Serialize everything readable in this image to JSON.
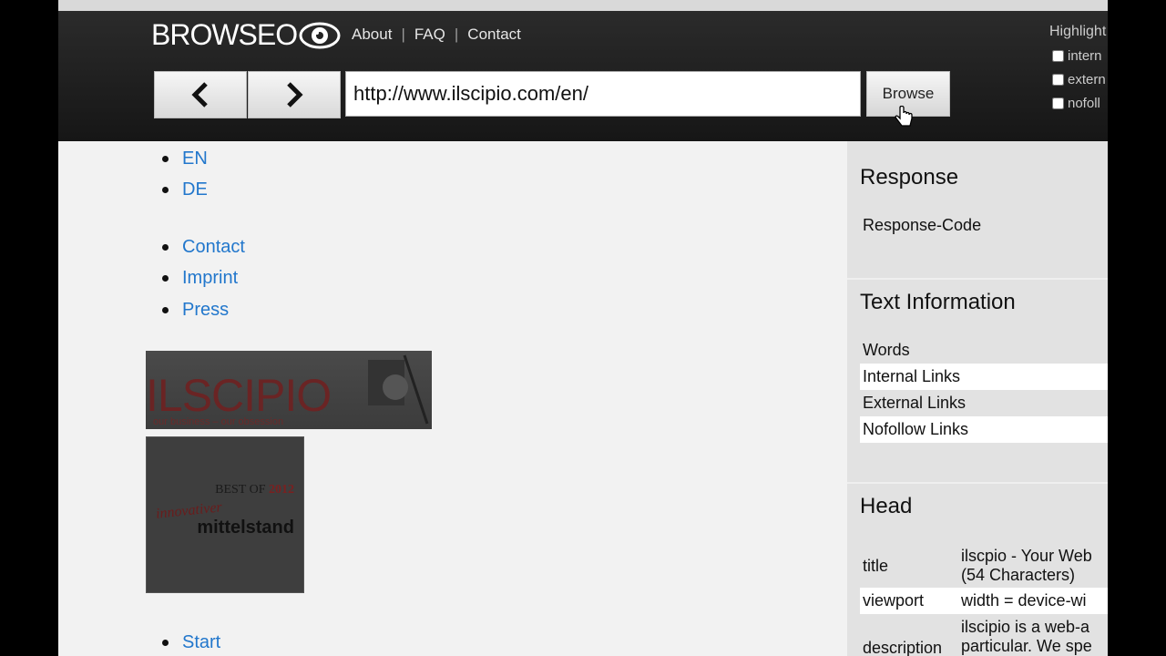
{
  "header": {
    "logo_text": "BROWSEO",
    "nav": [
      "About",
      "FAQ",
      "Contact"
    ],
    "url_value": "http://www.ilscipio.com/en/",
    "browse_label": "Browse"
  },
  "highlight": {
    "title": "Highlight",
    "options": [
      "intern",
      "extern",
      "nofoll"
    ]
  },
  "page_content": {
    "lang_links": [
      "EN",
      "DE"
    ],
    "footer_links": [
      "Contact",
      "Imprint",
      "Press"
    ],
    "banner1": {
      "text": "ILSCIPIO",
      "sub": "our business – our obsession"
    },
    "banner2": {
      "best": "BEST OF",
      "year": "2012",
      "script": "innovativer",
      "name": "mittelstand"
    },
    "bottom_links": [
      "Start"
    ]
  },
  "panel": {
    "response": {
      "heading": "Response",
      "label": "Response-Code"
    },
    "text_info": {
      "heading": "Text Information",
      "rows": [
        "Words",
        "Internal Links",
        "External Links",
        "Nofollow Links"
      ]
    },
    "head": {
      "heading": "Head",
      "rows": [
        {
          "key": "title",
          "value_line1": "ilscpio - Your Web",
          "value_line2": "(54 Characters)"
        },
        {
          "key": "viewport",
          "value_line1": "width = device-wi",
          "value_line2": ""
        },
        {
          "key": "description",
          "value_line1": "ilscipio is a web-a",
          "value_line2": "particular. We spe"
        }
      ]
    }
  },
  "colors": {
    "link": "#2277cc",
    "header_bg": "#1e1e1e",
    "panel_bg": "#e2e2e2"
  }
}
